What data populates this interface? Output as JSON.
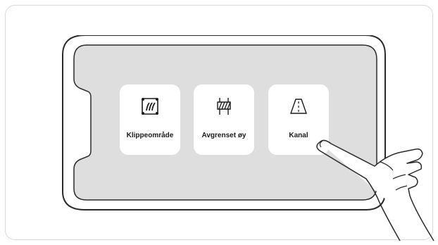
{
  "tiles": [
    {
      "label": "Klippeområde",
      "icon": "grass-cutting-area-icon"
    },
    {
      "label": "Avgrenset øy",
      "icon": "fenced-island-icon"
    },
    {
      "label": "Kanal",
      "icon": "channel-path-icon"
    }
  ],
  "colors": {
    "screen": "#dedede",
    "tile": "#ffffff",
    "outline": "#2a2a2a"
  }
}
